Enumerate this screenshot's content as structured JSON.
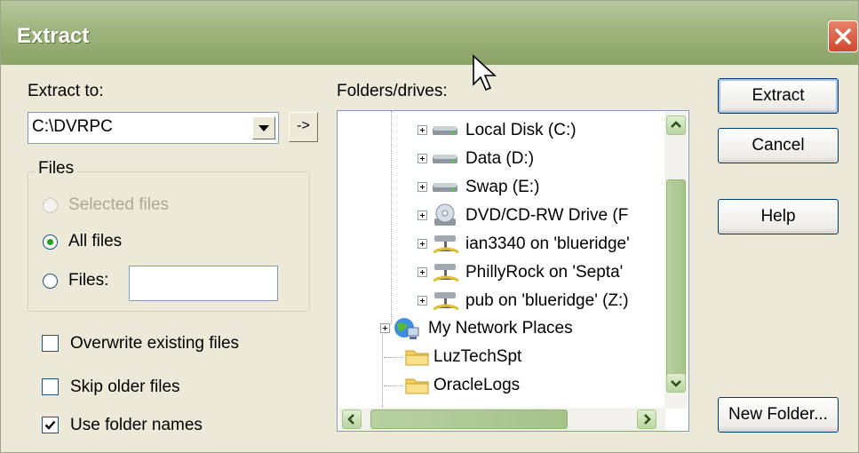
{
  "window": {
    "title": "Extract"
  },
  "extract_to": {
    "label": "Extract to:",
    "path_value": "C:\\DVRPC",
    "arrow_button_label": "->"
  },
  "files_group": {
    "title": "Files",
    "options": [
      {
        "label": "Selected files",
        "state": "disabled"
      },
      {
        "label": "All files",
        "state": "checked"
      },
      {
        "label": "Files:",
        "state": "unchecked"
      }
    ],
    "files_input_value": ""
  },
  "checkboxes": [
    {
      "label": "Overwrite existing files",
      "checked": false
    },
    {
      "label": "Skip older files",
      "checked": false
    },
    {
      "label": "Use folder names",
      "checked": true
    }
  ],
  "folders": {
    "label": "Folders/drives:",
    "items": [
      {
        "label": "Local Disk (C:)",
        "icon": "hard-drive-icon"
      },
      {
        "label": "Data (D:)",
        "icon": "hard-drive-icon"
      },
      {
        "label": "Swap (E:)",
        "icon": "hard-drive-icon"
      },
      {
        "label": "DVD/CD-RW Drive (F",
        "icon": "dvd-drive-icon"
      },
      {
        "label": "ian3340 on 'blueridge'",
        "icon": "network-drive-icon"
      },
      {
        "label": "PhillyRock on 'Septa'",
        "icon": "network-drive-icon"
      },
      {
        "label": "pub on 'blueridge' (Z:)",
        "icon": "network-drive-icon"
      },
      {
        "label": "My Network Places",
        "icon": "network-places-icon"
      },
      {
        "label": "LuzTechSpt",
        "icon": "folder-icon"
      },
      {
        "label": "OracleLogs",
        "icon": "folder-icon"
      }
    ]
  },
  "buttons": {
    "extract": "Extract",
    "cancel": "Cancel",
    "help": "Help",
    "new_folder": "New Folder..."
  }
}
